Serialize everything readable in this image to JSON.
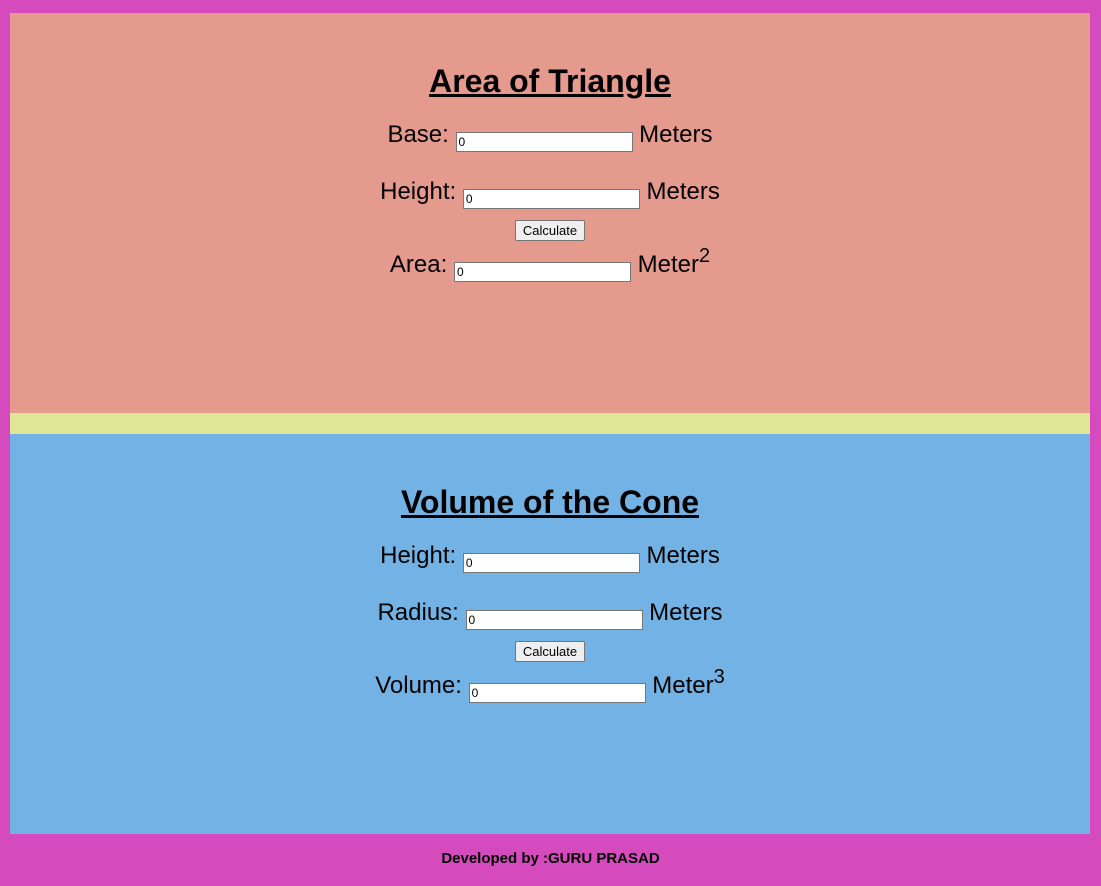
{
  "triangle": {
    "title": "Area of Triangle",
    "base_label": "Base:",
    "base_value": "0",
    "base_unit": "Meters",
    "height_label": "Height:",
    "height_value": "0",
    "height_unit": "Meters",
    "calculate_label": "Calculate",
    "area_label": "Area:",
    "area_value": "0",
    "area_unit": "Meter",
    "area_unit_exp": "2"
  },
  "cone": {
    "title": "Volume of the Cone",
    "height_label": "Height:",
    "height_value": "0",
    "height_unit": "Meters",
    "radius_label": "Radius:",
    "radius_value": "0",
    "radius_unit": "Meters",
    "calculate_label": "Calculate",
    "volume_label": "Volume:",
    "volume_value": "0",
    "volume_unit": "Meter",
    "volume_unit_exp": "3"
  },
  "footer": {
    "text": "Developed by :GURU PRASAD"
  },
  "colors": {
    "page_bg": "#d54abc",
    "triangle_bg": "#e59a8e",
    "separator_bg": "#dfe696",
    "cone_bg": "#72b2e4"
  }
}
